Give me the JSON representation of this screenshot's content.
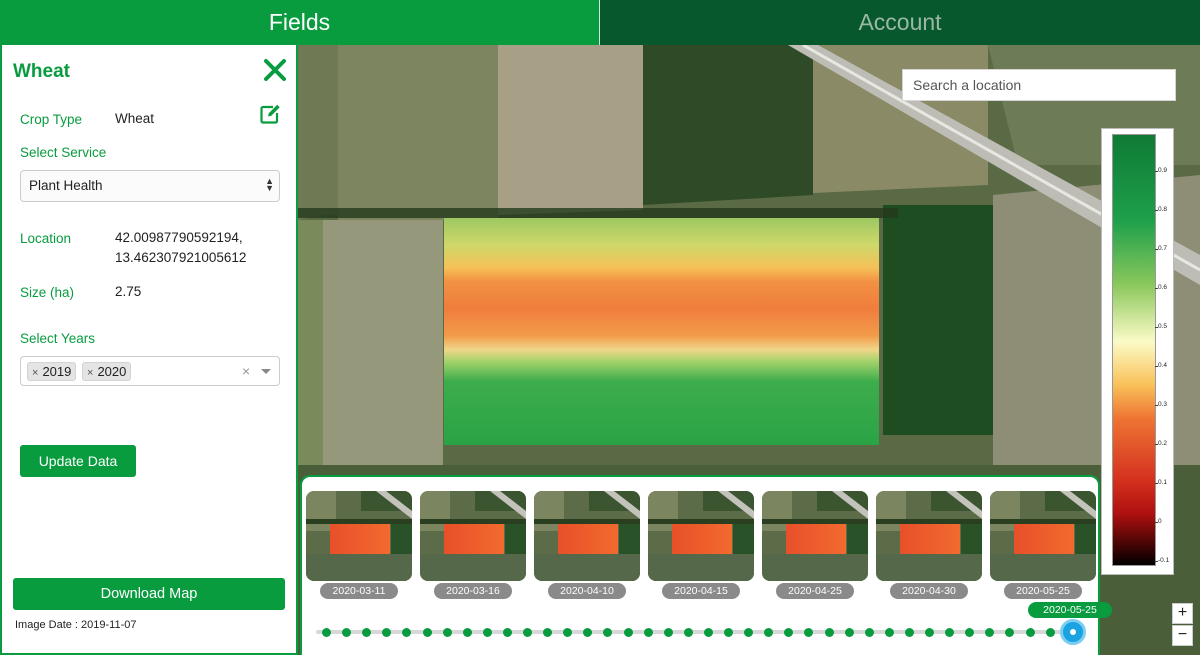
{
  "tabs": [
    {
      "label": "Fields",
      "active": true
    },
    {
      "label": "Account",
      "active": false
    }
  ],
  "sidebar": {
    "title": "Wheat",
    "crop_type_label": "Crop Type",
    "crop_type_value": "Wheat",
    "select_service_label": "Select Service",
    "service_selected": "Plant Health",
    "location_label": "Location",
    "location_lat": "42.00987790592194,",
    "location_lon": "13.462307921005612",
    "size_label": "Size (ha)",
    "size_value": "2.75",
    "select_years_label": "Select Years",
    "years_selected": [
      "2019",
      "2020"
    ],
    "update_button": "Update Data",
    "download_button": "Download Map",
    "image_date": "Image Date : 2019-11-07"
  },
  "map": {
    "search_placeholder": "Search a location",
    "legend_ticks": [
      "0.9",
      "0.8",
      "0.7",
      "0.6",
      "0.5",
      "0.4",
      "0.3",
      "0.2",
      "0.1",
      "0",
      "-0.1"
    ],
    "zoom_in": "+",
    "zoom_out": "−"
  },
  "timeline": {
    "thumbnails": [
      "2020-03-11",
      "2020-03-16",
      "2020-04-10",
      "2020-04-15",
      "2020-04-25",
      "2020-04-30",
      "2020-05-25"
    ],
    "current_date": "2020-05-25",
    "dot_count": 37
  },
  "colors": {
    "primary": "#089c3f",
    "tab_inactive": "#07582c",
    "slider_handle": "#1aa3e0"
  }
}
